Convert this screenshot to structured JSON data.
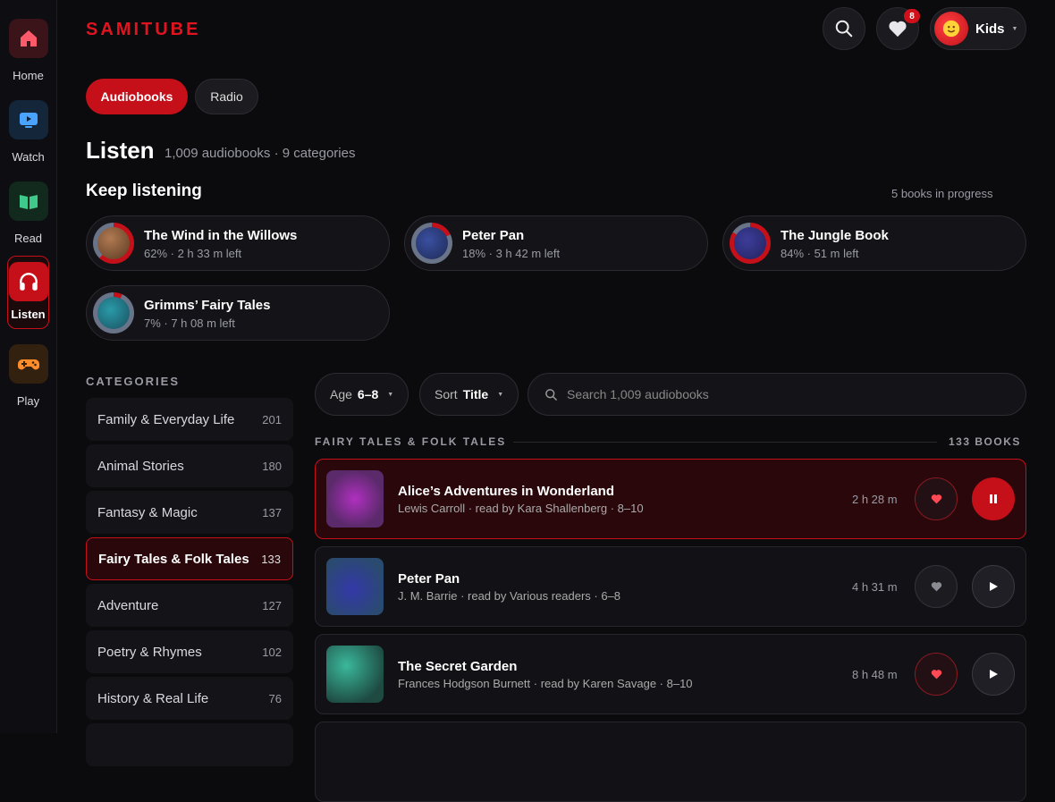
{
  "nav": [
    {
      "label": "Home",
      "icon": "house-icon"
    },
    {
      "label": "Watch",
      "icon": "tv-icon"
    },
    {
      "label": "Read",
      "icon": "book-icon"
    },
    {
      "label": "Listen",
      "icon": "headphones-icon"
    },
    {
      "label": "Play",
      "icon": "gamepad-icon"
    }
  ],
  "brand": "SAMITUBE",
  "favorites_badge": "8",
  "profile": {
    "name": "Kids"
  },
  "tabs": {
    "active": "Audiobooks",
    "other": "Radio"
  },
  "heading": {
    "title": "Listen",
    "subtitle": "1,009 audiobooks · 9 categories"
  },
  "keep_listening": {
    "title": "Keep listening",
    "note": "5 books in progress",
    "items": [
      {
        "title": "The Wind in the Willows",
        "meta": "62% · 2 h 33 m left",
        "progress": 0.62
      },
      {
        "title": "Peter Pan",
        "meta": "18% · 3 h 42 m left",
        "progress": 0.18
      },
      {
        "title": "The Jungle Book",
        "meta": "84% · 51 m left",
        "progress": 0.84
      },
      {
        "title": "Grimms’ Fairy Tales",
        "meta": "7% · 7 h 08 m left",
        "progress": 0.07
      }
    ]
  },
  "categories": {
    "title": "CATEGORIES",
    "items": [
      {
        "label": "Family & Everyday Life",
        "count": "201"
      },
      {
        "label": "Animal Stories",
        "count": "180"
      },
      {
        "label": "Fantasy & Magic",
        "count": "137"
      },
      {
        "label": "Fairy Tales & Folk Tales",
        "count": "133",
        "selected": true
      },
      {
        "label": "Adventure",
        "count": "127"
      },
      {
        "label": "Poetry & Rhymes",
        "count": "102"
      },
      {
        "label": "History & Real Life",
        "count": "76"
      }
    ]
  },
  "filters": {
    "age_label": "Age",
    "age_value": "6–8",
    "sort_label": "Sort",
    "sort_value": "Title",
    "search_placeholder": "Search 1,009 audiobooks"
  },
  "section": {
    "title": "FAIRY TALES & FOLK TALES",
    "count": "133 BOOKS"
  },
  "books": [
    {
      "title": "Alice’s Adventures in Wonderland",
      "meta": "Lewis Carroll · read by Kara Shallenberg · 8–10",
      "duration": "2 h 28 m",
      "favorite": true,
      "playing": true
    },
    {
      "title": "Peter Pan",
      "meta": "J. M. Barrie · read by Various readers · 6–8",
      "duration": "4 h 31 m",
      "favorite": false,
      "playing": false
    },
    {
      "title": "The Secret Garden",
      "meta": "Frances Hodgson Burnett · read by Karen Savage · 8–10",
      "duration": "8 h 48 m",
      "favorite": true,
      "playing": false
    }
  ],
  "colors": {
    "accent": "#c5101a",
    "brand": "#e0141f",
    "background": "#0b0b0e"
  }
}
